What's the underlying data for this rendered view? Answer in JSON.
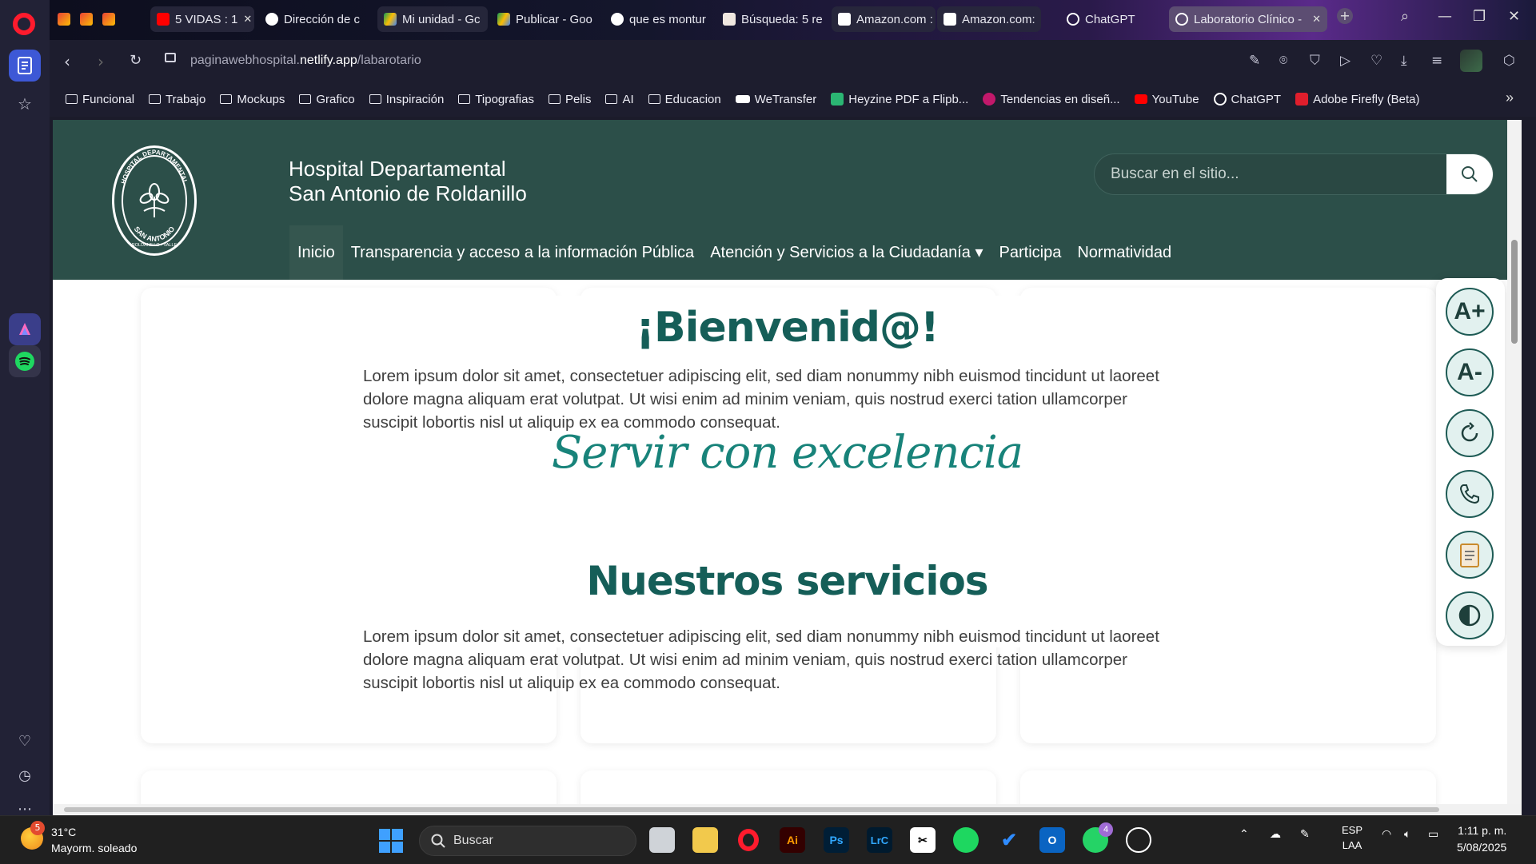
{
  "browser": {
    "tabs": [
      {
        "label": "",
        "icon": "gmail-icon"
      },
      {
        "label": "",
        "icon": "gmail-icon"
      },
      {
        "label": "",
        "icon": "gmail-icon"
      },
      {
        "label": "5 VIDAS : 1",
        "icon": "youtube-icon"
      },
      {
        "label": "Dirección de c",
        "icon": "google-icon"
      },
      {
        "label": "Mi unidad - Gc",
        "icon": "drive-icon"
      },
      {
        "label": "Publicar - Goo",
        "icon": "drive-icon"
      },
      {
        "label": "que es montur",
        "icon": "google-icon"
      },
      {
        "label": "Búsqueda: 5 re",
        "icon": "search-result-icon"
      },
      {
        "label": "Amazon.com :",
        "icon": "amazon-icon"
      },
      {
        "label": "Amazon.com:",
        "icon": "amazon-icon"
      },
      {
        "label": "ChatGPT",
        "icon": "chatgpt-icon"
      },
      {
        "label": "Laboratorio Clínico -",
        "icon": "globe-icon"
      }
    ],
    "url_host": "paginawebhospital.netlify.app",
    "url_path": "/labarotario",
    "url_prefix": "paginawebhospital.",
    "url_domain": "netlify.app"
  },
  "bookmarks": [
    {
      "label": "Funcional"
    },
    {
      "label": "Trabajo"
    },
    {
      "label": "Mockups"
    },
    {
      "label": "Grafico"
    },
    {
      "label": "Inspiración"
    },
    {
      "label": "Tipografias"
    },
    {
      "label": "Pelis"
    },
    {
      "label": "AI"
    },
    {
      "label": "Educacion"
    },
    {
      "label": "WeTransfer"
    },
    {
      "label": "Heyzine PDF a Flipb..."
    },
    {
      "label": "Tendencias en diseñ..."
    },
    {
      "label": "YouTube"
    },
    {
      "label": "ChatGPT"
    },
    {
      "label": "Adobe Firefly (Beta)"
    }
  ],
  "site": {
    "title_line1": "Hospital Departamental",
    "title_line2": "San Antonio de Roldanillo",
    "search_placeholder": "Buscar en el sitio...",
    "seal_top": "HOSPITAL DEPARTAMENTAL",
    "seal_bottom": "SAN ANTONIO",
    "seal_foot": "ROLDANILLO - VALLE",
    "nav": [
      {
        "label": "Inicio"
      },
      {
        "label": "Transparencia y acceso a la información Pública"
      },
      {
        "label": "Atención y Servicios a la Ciudadanía ▾"
      },
      {
        "label": "Participa"
      },
      {
        "label": "Normatividad"
      }
    ],
    "welcome": "¡Bienvenid@!",
    "intro_text": "Lorem ipsum dolor sit amet, consectetuer adipiscing elit, sed diam nonummy nibh euismod tincidunt ut laoreet dolore magna aliquam erat volutpat. Ut wisi enim ad minim veniam, quis nostrud exerci tation ullamcorper suscipit lobortis nisl ut aliquip ex ea commodo consequat.",
    "slogan": "Servir con excelencia",
    "services_title": "Nuestros servicios",
    "services_text": "Lorem ipsum dolor sit amet, consectetuer adipiscing elit, sed diam nonummy nibh euismod tincidunt ut laoreet dolore magna aliquam erat volutpat. Ut wisi enim ad minim veniam, quis nostrud exerci tation ullamcorper suscipit lobortis nisl ut aliquip ex ea commodo consequat.",
    "a11y": {
      "increase_label": "A+",
      "decrease_label": "A-"
    },
    "colors": {
      "header": "#2c4f49",
      "heading": "#155e58",
      "accent": "#18837a"
    }
  },
  "taskbar": {
    "weather_badge": "5",
    "temperature": "31°C",
    "weather_desc": "Mayorm. soleado",
    "search_label": "Buscar",
    "whatsapp_badge": "4",
    "lang_top": "ESP",
    "lang_bottom": "LAA",
    "time": "1:11 p. m.",
    "date": "5/08/2025"
  }
}
